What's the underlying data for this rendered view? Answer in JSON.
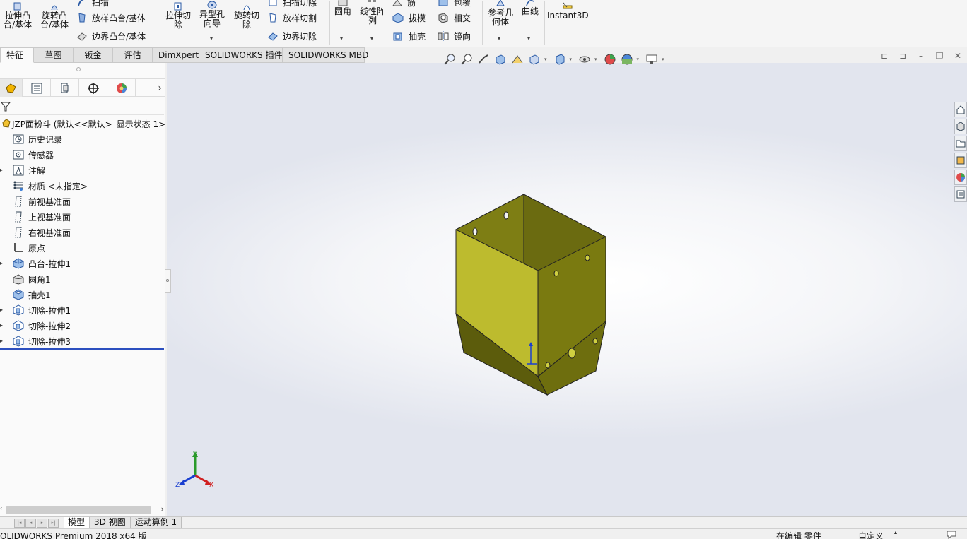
{
  "ribbon": {
    "extrude_boss": "拉伸凸\n台/基体",
    "revolve_boss": "旋转凸\n台/基体",
    "sweep": "扫描",
    "loft_boss": "放样凸台/基体",
    "boundary_boss": "边界凸台/基体",
    "extrude_cut": "拉伸切\n除",
    "hole_wizard": "异型孔\n向导",
    "revolve_cut": "旋转切\n除",
    "sweep_cut": "扫描切除",
    "loft_cut": "放样切割",
    "boundary_cut": "边界切除",
    "fillet": "圆角",
    "linear_pattern": "线性阵\n列",
    "rib": "筋",
    "draft": "拔模",
    "shell": "抽壳",
    "wrap": "包覆",
    "intersect": "相交",
    "mirror": "镜向",
    "ref_geometry": "参考几\n何体",
    "curves": "曲线",
    "instant3d": "Instant3D"
  },
  "command_tabs": [
    "特征",
    "草图",
    "钣金",
    "评估",
    "DimXpert",
    "SOLIDWORKS 插件",
    "SOLIDWORKS MBD"
  ],
  "tree": {
    "root": "JZP面粉斗 (默认<<默认>_显示状态 1>",
    "items": [
      {
        "label": "历史记录",
        "icon": "history-icon",
        "expand": false
      },
      {
        "label": "传感器",
        "icon": "sensor-icon",
        "expand": false
      },
      {
        "label": "注解",
        "icon": "annotation-icon",
        "expand": true
      },
      {
        "label": "材质 <未指定>",
        "icon": "material-icon",
        "expand": false
      },
      {
        "label": "前视基准面",
        "icon": "plane-icon",
        "expand": false
      },
      {
        "label": "上视基准面",
        "icon": "plane-icon",
        "expand": false
      },
      {
        "label": "右视基准面",
        "icon": "plane-icon",
        "expand": false
      },
      {
        "label": "原点",
        "icon": "origin-icon",
        "expand": false
      },
      {
        "label": "凸台-拉伸1",
        "icon": "boss-extrude-icon",
        "expand": true
      },
      {
        "label": "圆角1",
        "icon": "fillet-icon",
        "expand": false
      },
      {
        "label": "抽壳1",
        "icon": "shell-icon",
        "expand": false
      },
      {
        "label": "切除-拉伸1",
        "icon": "cut-extrude-icon",
        "expand": true
      },
      {
        "label": "切除-拉伸2",
        "icon": "cut-extrude-icon",
        "expand": true
      },
      {
        "label": "切除-拉伸3",
        "icon": "cut-extrude-icon",
        "expand": true
      }
    ]
  },
  "triad": {
    "x": "X",
    "y": "Y",
    "z": "Z"
  },
  "bottom_tabs": [
    "模型",
    "3D 视图",
    "运动算例 1"
  ],
  "status": {
    "product": "OLIDWORKS Premium 2018 x64 版",
    "mode": "在编辑 零件",
    "units": "自定义"
  },
  "colors": {
    "part_light": "#7e7e14",
    "part_face": "#bdbb2e",
    "part_dark": "#5c5c0c",
    "rollback": "#2c4fbf"
  }
}
